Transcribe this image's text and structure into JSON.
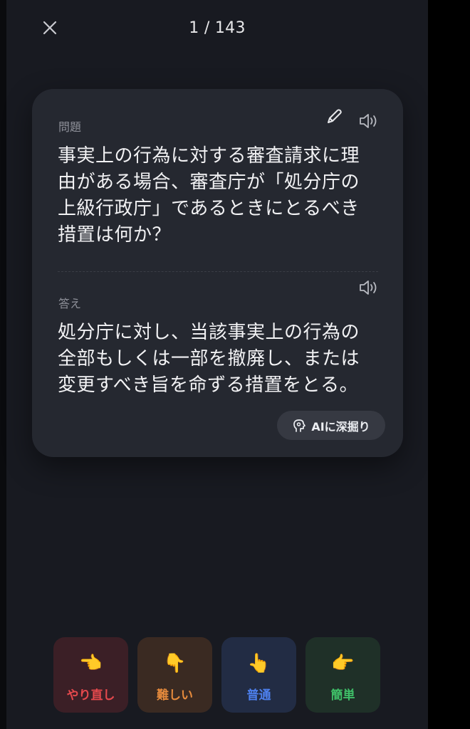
{
  "header": {
    "counter": "1 / 143"
  },
  "card": {
    "question_label": "問題",
    "question_text": "事実上の行為に対する審査請求に理由がある場合、審査庁が「処分庁の上級行政庁」であるときにとるべき措置は何か？",
    "answer_label": "答え",
    "answer_text": "処分庁に対し、当該事実上の行為の全部もしくは一部を撤廃し、または変更すべき旨を命ずる措置をとる。",
    "ai_button_label": "AIに深掘り"
  },
  "ratings": [
    {
      "label": "やり直し",
      "emoji": "👈",
      "color": "#e5494d"
    },
    {
      "label": "難しい",
      "emoji": "👇",
      "color": "#e58a3c"
    },
    {
      "label": "普通",
      "emoji": "👆",
      "color": "#4d80ee"
    },
    {
      "label": "簡単",
      "emoji": "👉",
      "color": "#3fbf68"
    }
  ],
  "icons": {
    "close": "close-icon",
    "edit": "pencil-icon",
    "audio": "speaker-icon",
    "ai": "ai-head-icon"
  }
}
